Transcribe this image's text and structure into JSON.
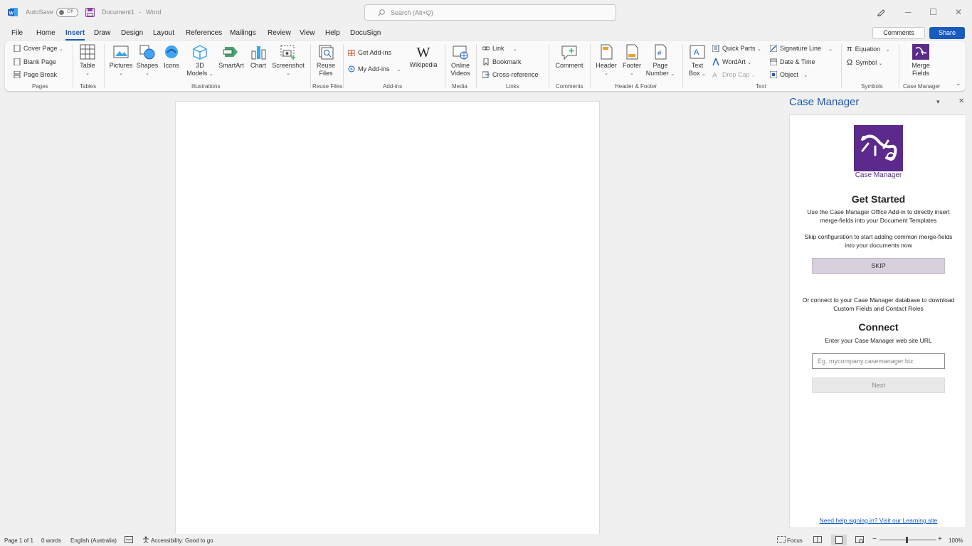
{
  "titlebar": {
    "autosave_label": "AutoSave",
    "autosave_state": "Off",
    "doc_name": "Document1",
    "separator": "-",
    "app_name": "Word",
    "search_placeholder": "Search (Alt+Q)"
  },
  "menu": {
    "items": [
      "File",
      "Home",
      "Insert",
      "Draw",
      "Design",
      "Layout",
      "References",
      "Mailings",
      "Review",
      "View",
      "Help",
      "DocuSign"
    ],
    "active": "Insert",
    "comments_label": "Comments",
    "share_label": "Share"
  },
  "ribbon": {
    "pages": {
      "label": "Pages",
      "cover_page": "Cover Page",
      "blank_page": "Blank Page",
      "page_break": "Page Break"
    },
    "tables": {
      "label": "Tables",
      "table": "Table"
    },
    "illustrations": {
      "label": "Illustrations",
      "pictures": "Pictures",
      "shapes": "Shapes",
      "icons": "Icons",
      "models_3d_l1": "3D",
      "models_3d_l2": "Models",
      "smartart": "SmartArt",
      "chart": "Chart",
      "screenshot": "Screenshot"
    },
    "reuse_files": {
      "label": "Reuse Files",
      "reuse_l1": "Reuse",
      "reuse_l2": "Files"
    },
    "addins": {
      "label": "Add-ins",
      "get_addins": "Get Add-ins",
      "my_addins": "My Add-ins",
      "wikipedia": "Wikipedia"
    },
    "media": {
      "label": "Media",
      "online_l1": "Online",
      "online_l2": "Videos"
    },
    "links": {
      "label": "Links",
      "link": "Link",
      "bookmark": "Bookmark",
      "cross_reference": "Cross-reference"
    },
    "comments": {
      "label": "Comments",
      "comment": "Comment"
    },
    "header_footer": {
      "label": "Header & Footer",
      "header": "Header",
      "footer": "Footer",
      "page_l1": "Page",
      "page_l2": "Number"
    },
    "text": {
      "label": "Text",
      "textbox_l1": "Text",
      "textbox_l2": "Box",
      "quick_parts": "Quick Parts",
      "wordart": "WordArt",
      "drop_cap": "Drop Cap",
      "signature_line": "Signature Line",
      "date_time": "Date & Time",
      "object": "Object"
    },
    "symbols": {
      "label": "Symbols",
      "equation": "Equation",
      "symbol": "Symbol"
    },
    "case_manager": {
      "label": "Case Manager",
      "merge_l1": "Merge",
      "merge_l2": "Fields"
    }
  },
  "pane": {
    "title": "Case Manager",
    "logo_caption": "Case Manager",
    "get_started": "Get Started",
    "intro_l1": "Use the Case Manager Office Add-in to directly insert",
    "intro_l2": "merge-fields into your Document Templates",
    "skip_l1": "Skip configuration to start adding common merge-fields",
    "skip_l2": "into your documents now",
    "skip_button": "SKIP",
    "or_l1": "Or connect to your Case Manager database to download",
    "or_l2": "Custom Fields and Contact Roles",
    "connect": "Connect",
    "url_label": "Enter your Case Manager web site URL",
    "url_placeholder": "Eg. mycompany.casemanager.biz",
    "next_button": "Next",
    "help_link": "Need help signing in? Visit our Learning site",
    "brand_color": "#5b2a8c"
  },
  "status": {
    "page": "Page 1 of 1",
    "words": "0 words",
    "language": "English (Australia)",
    "accessibility": "Accessibility: Good to go",
    "focus": "Focus",
    "zoom": "100%"
  }
}
